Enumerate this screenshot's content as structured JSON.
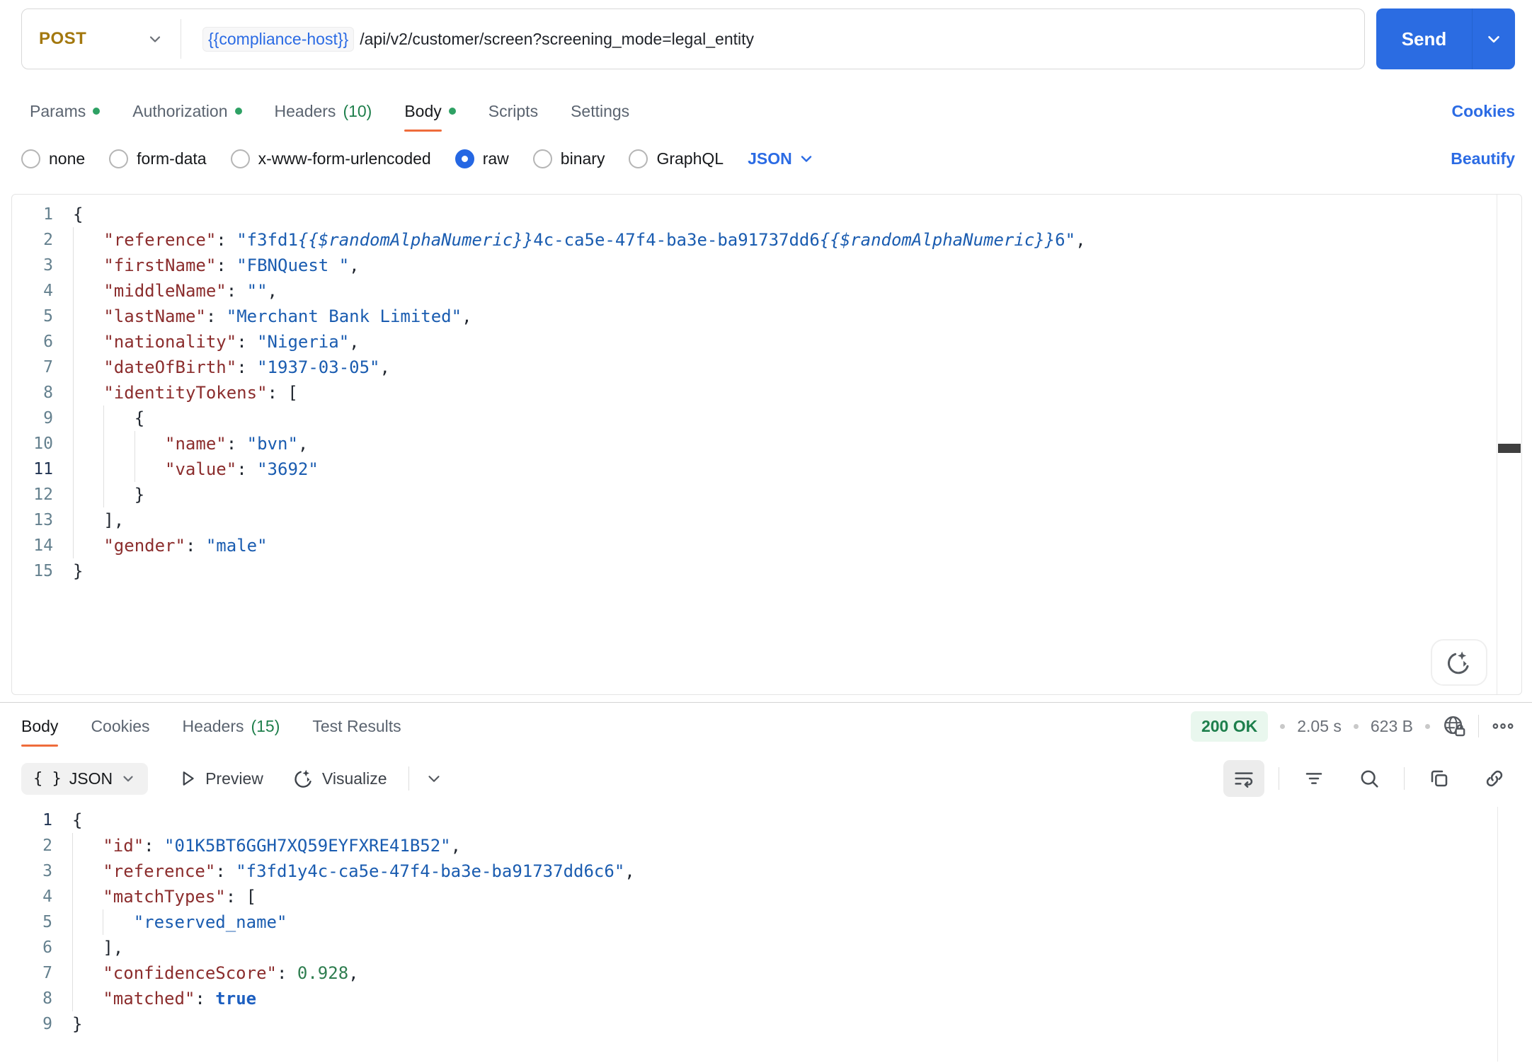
{
  "request": {
    "method": "POST",
    "url_host": "{{compliance-host}}",
    "url_path": "/api/v2/customer/screen?screening_mode=legal_entity",
    "send_label": "Send"
  },
  "request_tabs": {
    "items": [
      {
        "label": "Params",
        "dot": true
      },
      {
        "label": "Authorization",
        "dot": true
      },
      {
        "label": "Headers",
        "count": "(10)"
      },
      {
        "label": "Body",
        "dot": true,
        "active": true
      },
      {
        "label": "Scripts"
      },
      {
        "label": "Settings"
      }
    ],
    "cookies_link": "Cookies"
  },
  "body_type": {
    "options": [
      "none",
      "form-data",
      "x-www-form-urlencoded",
      "raw",
      "binary",
      "GraphQL"
    ],
    "selected": "raw",
    "language": "JSON",
    "beautify_link": "Beautify"
  },
  "request_editor": {
    "active_line": 11,
    "lines": [
      {
        "n": 1,
        "indent": 0,
        "segs": [
          [
            "pun",
            "{"
          ]
        ]
      },
      {
        "n": 2,
        "indent": 1,
        "segs": [
          [
            "key",
            "\"reference\""
          ],
          [
            "pun",
            ": "
          ],
          [
            "str",
            "\"f3fd1"
          ],
          [
            "var",
            "{{$randomAlphaNumeric}}"
          ],
          [
            "str",
            "4c-ca5e-47f4-ba3e-ba91737dd6"
          ],
          [
            "var",
            "{{$randomAlphaNumeric}}"
          ],
          [
            "str",
            "6\""
          ],
          [
            "pun",
            ","
          ]
        ]
      },
      {
        "n": 3,
        "indent": 1,
        "segs": [
          [
            "key",
            "\"firstName\""
          ],
          [
            "pun",
            ": "
          ],
          [
            "str",
            "\"FBNQuest \""
          ],
          [
            "pun",
            ","
          ]
        ]
      },
      {
        "n": 4,
        "indent": 1,
        "segs": [
          [
            "key",
            "\"middleName\""
          ],
          [
            "pun",
            ": "
          ],
          [
            "str",
            "\"\""
          ],
          [
            "pun",
            ","
          ]
        ]
      },
      {
        "n": 5,
        "indent": 1,
        "segs": [
          [
            "key",
            "\"lastName\""
          ],
          [
            "pun",
            ": "
          ],
          [
            "str",
            "\"Merchant Bank Limited\""
          ],
          [
            "pun",
            ","
          ]
        ]
      },
      {
        "n": 6,
        "indent": 1,
        "segs": [
          [
            "key",
            "\"nationality\""
          ],
          [
            "pun",
            ": "
          ],
          [
            "str",
            "\"Nigeria\""
          ],
          [
            "pun",
            ","
          ]
        ]
      },
      {
        "n": 7,
        "indent": 1,
        "segs": [
          [
            "key",
            "\"dateOfBirth\""
          ],
          [
            "pun",
            ": "
          ],
          [
            "str",
            "\"1937-03-05\""
          ],
          [
            "pun",
            ","
          ]
        ]
      },
      {
        "n": 8,
        "indent": 1,
        "segs": [
          [
            "key",
            "\"identityTokens\""
          ],
          [
            "pun",
            ": ["
          ]
        ]
      },
      {
        "n": 9,
        "indent": 2,
        "segs": [
          [
            "pun",
            "{"
          ]
        ]
      },
      {
        "n": 10,
        "indent": 3,
        "segs": [
          [
            "key",
            "\"name\""
          ],
          [
            "pun",
            ": "
          ],
          [
            "str",
            "\"bvn\""
          ],
          [
            "pun",
            ","
          ]
        ]
      },
      {
        "n": 11,
        "indent": 3,
        "segs": [
          [
            "key",
            "\"value\""
          ],
          [
            "pun",
            ": "
          ],
          [
            "str",
            "\"3692\""
          ]
        ]
      },
      {
        "n": 12,
        "indent": 2,
        "segs": [
          [
            "pun",
            "}"
          ]
        ]
      },
      {
        "n": 13,
        "indent": 1,
        "segs": [
          [
            "pun",
            "],"
          ]
        ]
      },
      {
        "n": 14,
        "indent": 1,
        "segs": [
          [
            "key",
            "\"gender\""
          ],
          [
            "pun",
            ": "
          ],
          [
            "str",
            "\"male\""
          ]
        ]
      },
      {
        "n": 15,
        "indent": 0,
        "segs": [
          [
            "pun",
            "}"
          ]
        ]
      }
    ]
  },
  "response_tabs": {
    "items": [
      {
        "label": "Body",
        "active": true
      },
      {
        "label": "Cookies"
      },
      {
        "label": "Headers",
        "count": "(15)"
      },
      {
        "label": "Test Results"
      }
    ]
  },
  "response_meta": {
    "status": "200 OK",
    "time": "2.05 s",
    "size": "623 B"
  },
  "response_toolbar": {
    "braces": "{ }",
    "format_label": "JSON",
    "preview_label": "Preview",
    "visualize_label": "Visualize"
  },
  "response_editor": {
    "active_line": 1,
    "lines": [
      {
        "n": 1,
        "indent": 0,
        "segs": [
          [
            "pun",
            "{"
          ]
        ]
      },
      {
        "n": 2,
        "indent": 1,
        "segs": [
          [
            "key",
            "\"id\""
          ],
          [
            "pun",
            ": "
          ],
          [
            "str",
            "\"01K5BT6GGH7XQ59EYFXRE41B52\""
          ],
          [
            "pun",
            ","
          ]
        ]
      },
      {
        "n": 3,
        "indent": 1,
        "segs": [
          [
            "key",
            "\"reference\""
          ],
          [
            "pun",
            ": "
          ],
          [
            "str",
            "\"f3fd1y4c-ca5e-47f4-ba3e-ba91737dd6c6\""
          ],
          [
            "pun",
            ","
          ]
        ]
      },
      {
        "n": 4,
        "indent": 1,
        "segs": [
          [
            "key",
            "\"matchTypes\""
          ],
          [
            "pun",
            ": ["
          ]
        ]
      },
      {
        "n": 5,
        "indent": 2,
        "segs": [
          [
            "str",
            "\"reserved_name\""
          ]
        ]
      },
      {
        "n": 6,
        "indent": 1,
        "segs": [
          [
            "pun",
            "],"
          ]
        ]
      },
      {
        "n": 7,
        "indent": 1,
        "segs": [
          [
            "key",
            "\"confidenceScore\""
          ],
          [
            "pun",
            ": "
          ],
          [
            "num",
            "0.928"
          ],
          [
            "pun",
            ","
          ]
        ]
      },
      {
        "n": 8,
        "indent": 1,
        "segs": [
          [
            "key",
            "\"matched\""
          ],
          [
            "pun",
            ": "
          ],
          [
            "bool",
            "true"
          ]
        ]
      },
      {
        "n": 9,
        "indent": 0,
        "segs": [
          [
            "pun",
            "}"
          ]
        ]
      }
    ]
  },
  "colors": {
    "method_post": "#A3780E",
    "send_button": "#2B6CE2",
    "link_blue": "#2B6BE4",
    "active_tab_underline": "#EF6C3B",
    "modified_dot_green": "#2EA164",
    "count_green": "#1F7F4C",
    "status_text_green": "#1D7F4C",
    "status_bg_green": "#E9F7EE",
    "code_key": "#8B2D2D",
    "code_string": "#1A5CB0",
    "code_number": "#2E7D4F",
    "code_boolean": "#1D5FC0"
  }
}
